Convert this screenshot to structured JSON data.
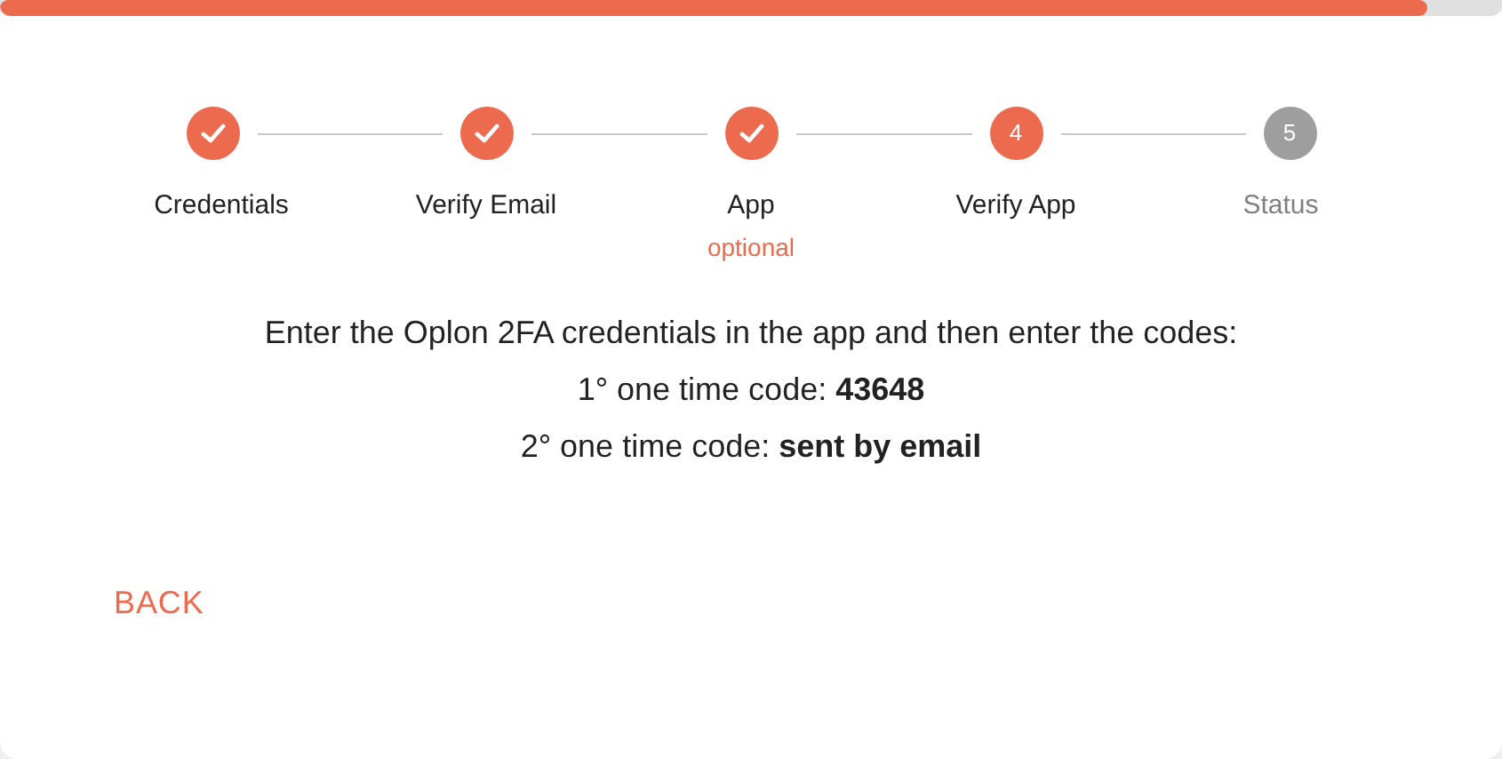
{
  "progress": {
    "level": 0.95
  },
  "steps": [
    {
      "label": "Credentials",
      "kind": "done"
    },
    {
      "label": "Verify Email",
      "kind": "done"
    },
    {
      "label": "App",
      "note": "optional",
      "kind": "done"
    },
    {
      "number": "4",
      "label": "Verify App",
      "kind": "current"
    },
    {
      "number": "5",
      "label": "Status",
      "kind": "pending"
    }
  ],
  "instructions": [
    "Enter the Oplon 2FA credentials in the app and then enter the codes:",
    "1° one time code: **43648**",
    "2° one time code: **sent by email**"
  ],
  "back_button": "BACK"
}
